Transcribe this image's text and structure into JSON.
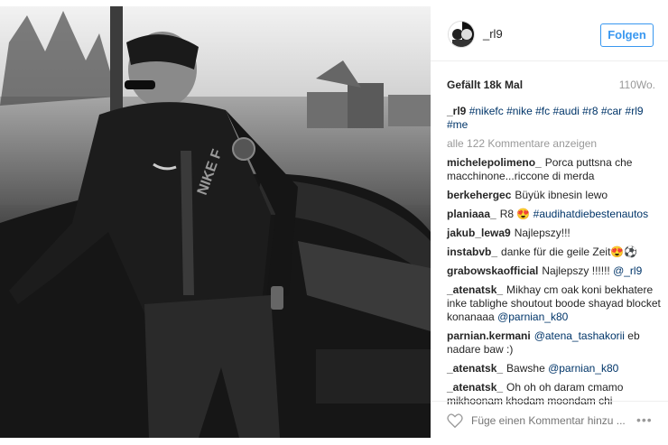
{
  "post": {
    "username": "_rl9",
    "follow_label": "Folgen",
    "likes": "Gefällt 18k Mal",
    "time": "110Wo.",
    "caption": {
      "user": "_rl9",
      "tags": [
        "#nikefc",
        "#nike",
        "#fc",
        "#audi",
        "#r8",
        "#car",
        "#rl9",
        "#me"
      ]
    },
    "view_all": "alle 122 Kommentare anzeigen",
    "comments": [
      {
        "user": "michelepolimeno_",
        "parts": [
          {
            "t": "Porca puttsna che macchinone...riccone di merda"
          }
        ]
      },
      {
        "user": "berkehergec",
        "parts": [
          {
            "t": "Büyük ibnesin lewo"
          }
        ]
      },
      {
        "user": "planiaaa_",
        "parts": [
          {
            "t": "R8 😍 "
          },
          {
            "t": "#audihatdiebestenautos",
            "link": true
          }
        ]
      },
      {
        "user": "jakub_lewa9",
        "parts": [
          {
            "t": "Najlepszy!!!"
          }
        ]
      },
      {
        "user": "instabvb_",
        "parts": [
          {
            "t": "danke für die geile Zeit😍⚽"
          }
        ]
      },
      {
        "user": "grabowskaofficial",
        "parts": [
          {
            "t": "Najlepszy !!!!!! "
          },
          {
            "t": "@_rl9",
            "link": true
          }
        ]
      },
      {
        "user": "_atenatsk_",
        "parts": [
          {
            "t": "Mikhay cm oak koni bekhatere inke tablighe shoutout boode shayad blocket konanaaa "
          },
          {
            "t": "@parnian_k80",
            "link": true
          }
        ]
      },
      {
        "user": "parnian.kermani",
        "parts": [
          {
            "t": "@atena_tashakorii",
            "link": true
          },
          {
            "t": " eb nadare baw :)"
          }
        ]
      },
      {
        "user": "_atenatsk_",
        "parts": [
          {
            "t": "Bawshe "
          },
          {
            "t": "@parnian_k80",
            "link": true
          }
        ]
      },
      {
        "user": "_atenatsk_",
        "parts": [
          {
            "t": "Oh oh oh daram cmamo mikhoonam khodam moondam chi"
          }
        ]
      }
    ],
    "add_comment_placeholder": "Füge einen Kommentar hinzu ...",
    "more_icon": "•••",
    "photo_text": "NIKE F"
  }
}
